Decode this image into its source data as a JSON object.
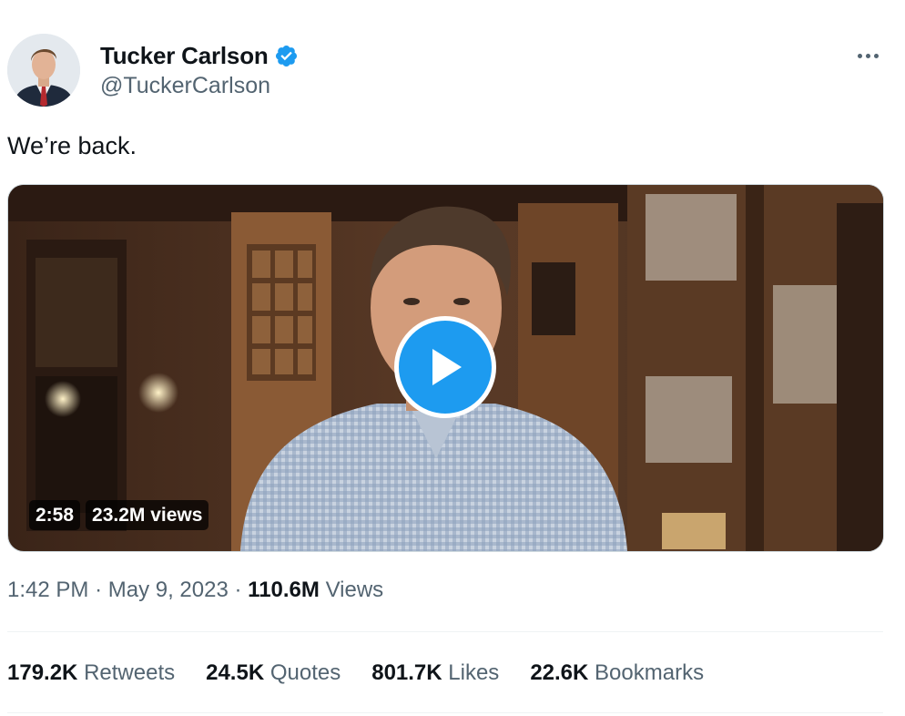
{
  "author": {
    "display_name": "Tucker Carlson",
    "handle": "@TuckerCarlson",
    "verified": true
  },
  "tweet": {
    "text": "We’re back."
  },
  "media": {
    "type": "video",
    "duration": "2:58",
    "views": "23.2M views"
  },
  "meta": {
    "time": "1:42 PM",
    "separator": "·",
    "date": "May 9, 2023",
    "views_count": "110.6M",
    "views_label": "Views"
  },
  "stats": [
    {
      "count": "179.2K",
      "label": "Retweets"
    },
    {
      "count": "24.5K",
      "label": "Quotes"
    },
    {
      "count": "801.7K",
      "label": "Likes"
    },
    {
      "count": "22.6K",
      "label": "Bookmarks"
    }
  ],
  "icons": {
    "verified": "verified-badge-icon",
    "more": "more-icon",
    "play": "play-icon"
  },
  "colors": {
    "accent": "#1d9bf0",
    "text_primary": "#0f1419",
    "text_secondary": "#536471"
  }
}
